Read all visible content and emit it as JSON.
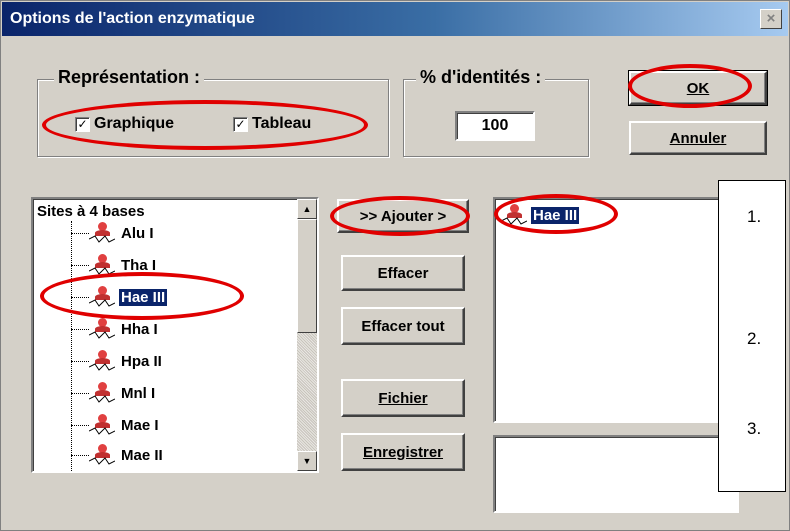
{
  "window": {
    "title": "Options de l'action enzymatique",
    "close_glyph": "×"
  },
  "representation": {
    "legend": "Représentation :",
    "graphique_label": "Graphique",
    "tableau_label": "Tableau",
    "graphique_checked": true,
    "tableau_checked": true,
    "check_glyph": "✓"
  },
  "identity": {
    "legend": "% d'identités :",
    "value": "100"
  },
  "buttons": {
    "ok": "OK",
    "cancel": "Annuler",
    "add": ">> Ajouter >",
    "clear": "Effacer",
    "clear_all": "Effacer tout",
    "file": "Fichier",
    "save": "Enregistrer"
  },
  "tree": {
    "root": "Sites à 4 bases",
    "items": [
      "Alu I",
      "Tha I",
      "Hae III",
      "Hha I",
      "Hpa II",
      "Mnl I",
      "Mae I",
      "Mae II"
    ],
    "selected": "Hae III"
  },
  "selected_list": {
    "items": [
      "Hae III"
    ]
  },
  "callout": {
    "numbers": [
      "1.",
      "2.",
      "3."
    ]
  },
  "colors": {
    "annotation_ring": "#e00000",
    "title_bar": "#0a246a",
    "selection": "#0a246a"
  }
}
